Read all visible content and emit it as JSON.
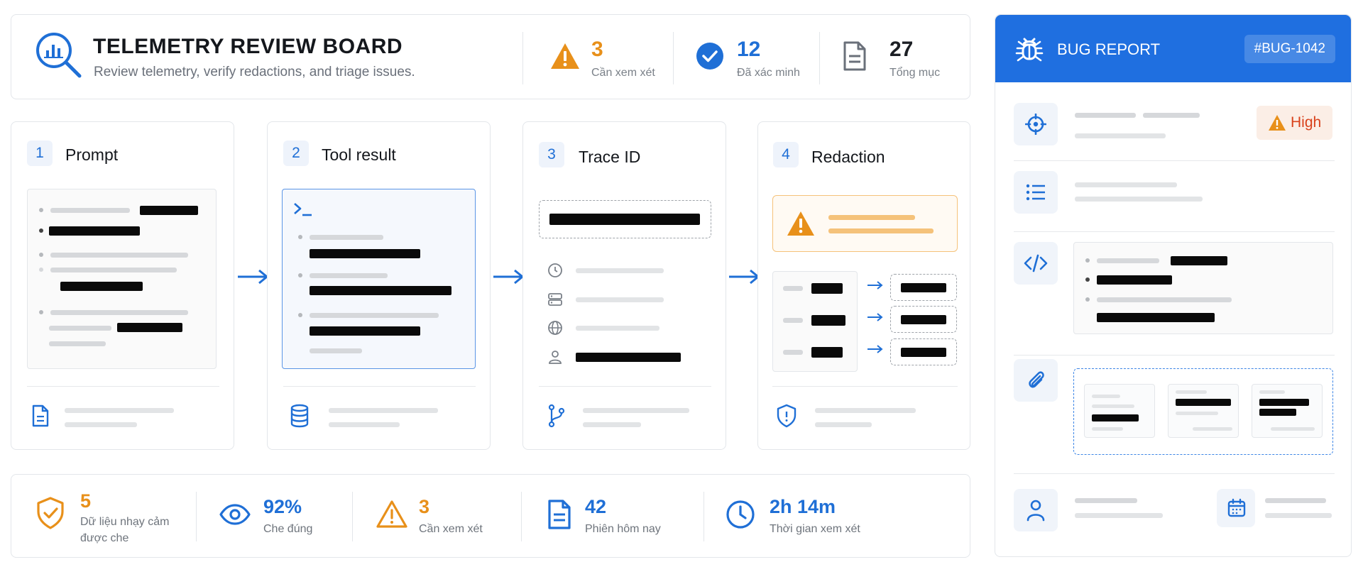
{
  "header": {
    "title": "TELEMETRY REVIEW BOARD",
    "subtitle": "Review telemetry, verify redactions, and triage issues.",
    "stats": [
      {
        "value": "3",
        "label": "Cần xem xét",
        "icon": "warning-icon",
        "color": "#e8901a"
      },
      {
        "value": "12",
        "label": "Đã xác minh",
        "icon": "check-circle-icon",
        "color": "#1f6fd6"
      },
      {
        "value": "27",
        "label": "Tổng mục",
        "icon": "document-icon",
        "color": "#1c1f24"
      }
    ]
  },
  "steps": [
    {
      "number": "1",
      "title": "Prompt",
      "footer_icon": "document-icon"
    },
    {
      "number": "2",
      "title": "Tool result",
      "footer_icon": "database-icon"
    },
    {
      "number": "3",
      "title": "Trace ID",
      "footer_icon": "branch-icon"
    },
    {
      "number": "4",
      "title": "Redaction",
      "footer_icon": "shield-icon"
    }
  ],
  "bug_report": {
    "title": "BUG REPORT",
    "id": "#BUG-1042",
    "severity": "High",
    "icons": [
      "bug-icon",
      "target-icon",
      "list-icon",
      "code-icon",
      "paperclip-icon",
      "user-icon",
      "calendar-icon"
    ]
  },
  "bottom_stats": [
    {
      "value": "5",
      "label_line1": "Dữ liệu nhạy cảm",
      "label_line2": "được che",
      "icon": "shield-check-icon",
      "color": "#e8901a"
    },
    {
      "value": "92%",
      "label_line1": "Che đúng",
      "label_line2": "",
      "icon": "eye-icon",
      "color": "#1f6fd6"
    },
    {
      "value": "3",
      "label_line1": "Cần xem xét",
      "label_line2": "",
      "icon": "warning-icon",
      "color": "#e8901a"
    },
    {
      "value": "42",
      "label_line1": "Phiên hôm nay",
      "label_line2": "",
      "icon": "document-icon",
      "color": "#1f6fd6"
    },
    {
      "value": "2h 14m",
      "label_line1": "Thời gian xem xét",
      "label_line2": "",
      "icon": "clock-icon",
      "color": "#1f6fd6"
    }
  ],
  "colors": {
    "accent": "#1f6fd6",
    "warning": "#e8901a",
    "danger": "#d9421c",
    "header_blue": "#1f6fe0"
  }
}
